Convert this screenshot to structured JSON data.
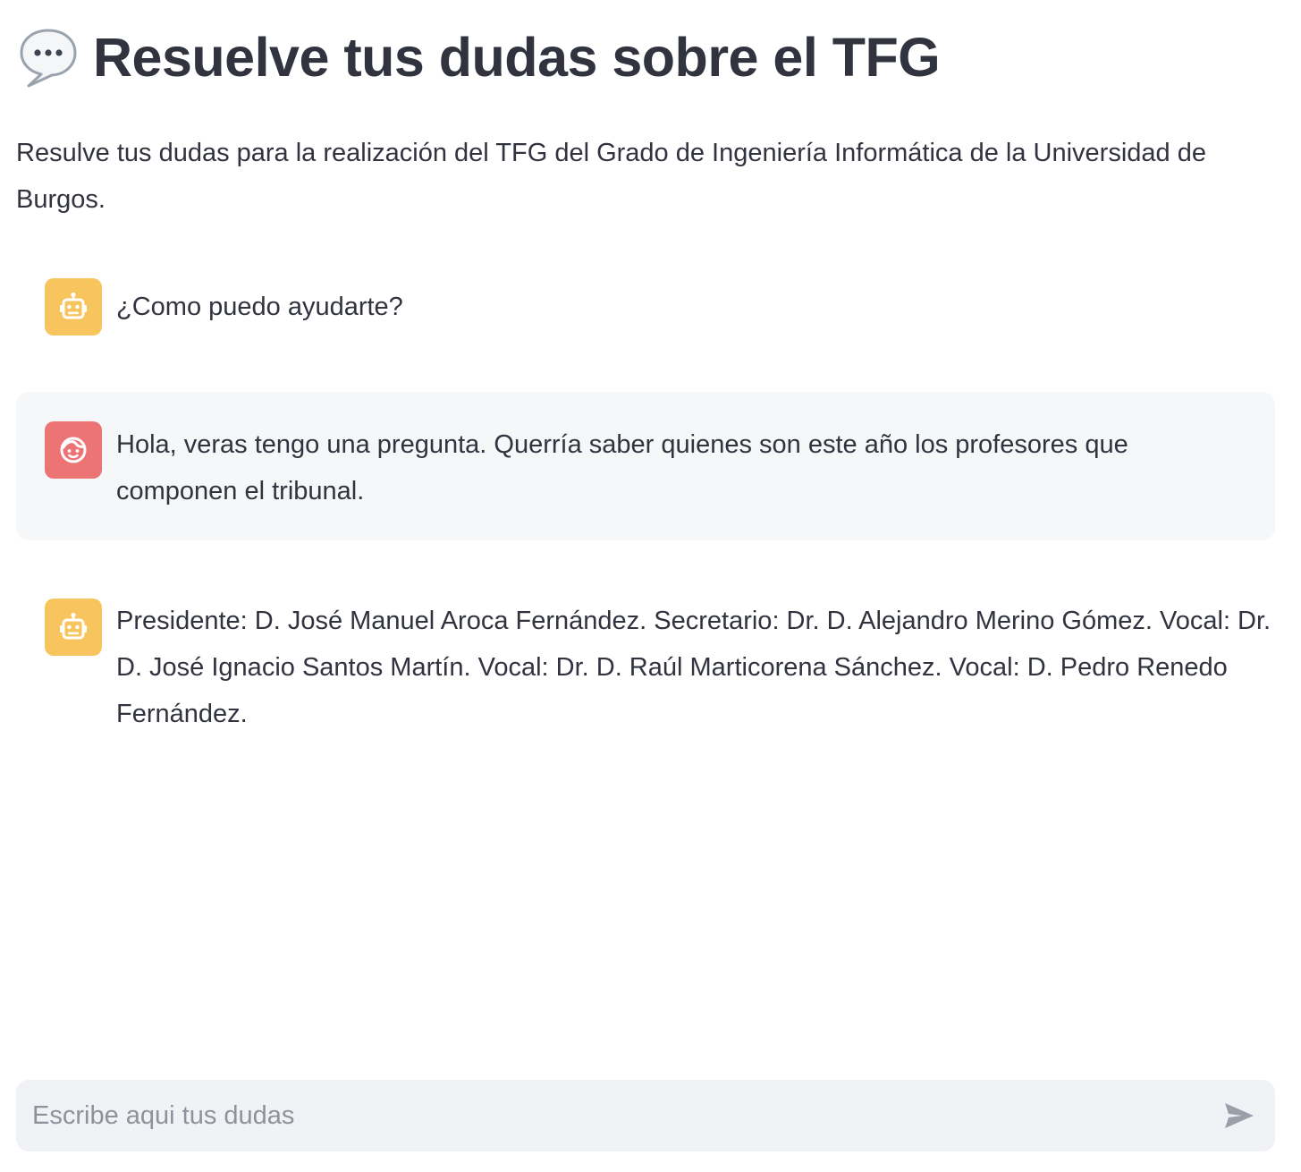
{
  "page": {
    "title_icon": "speech-balloon-emoji",
    "title": "Resuelve tus dudas sobre el TFG",
    "intro": "Resulve tus dudas para la realización del TFG del Grado de Ingeniería Informática de la Universidad de Burgos."
  },
  "messages": [
    {
      "role": "assistant",
      "avatar_icon": "robot-icon",
      "text": "¿Como puedo ayudarte?"
    },
    {
      "role": "user",
      "avatar_icon": "face-icon",
      "text": "Hola, veras tengo una pregunta. Querría saber quienes son este año los profesores que componen el tribunal."
    },
    {
      "role": "assistant",
      "avatar_icon": "robot-icon",
      "text": "Presidente: D. José Manuel Aroca Fernández. Secretario: Dr. D. Alejandro Merino Gómez. Vocal: Dr. D. José Ignacio Santos Martín. Vocal: Dr. D. Raúl Marticorena Sánchez. Vocal: D. Pedro Renedo Fernández."
    }
  ],
  "chat_input": {
    "placeholder": "Escribe aqui tus dudas",
    "value": "",
    "send_icon": "send-arrow-icon"
  },
  "colors": {
    "text": "#31333f",
    "assistant_avatar": "#f8c45d",
    "user_avatar": "#ec7474",
    "user_bubble": "#f6f7f9",
    "input_bg": "#f0f2f6",
    "placeholder": "#8f929c"
  }
}
